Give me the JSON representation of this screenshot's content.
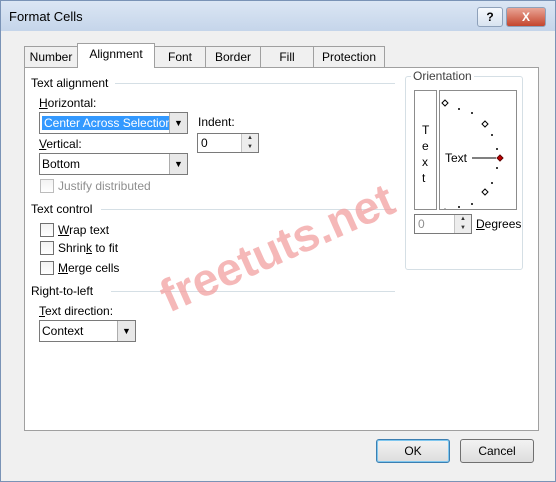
{
  "window": {
    "title": "Format Cells",
    "help_label": "?",
    "close_label": "X"
  },
  "tabs": [
    {
      "label": "Number",
      "active": false
    },
    {
      "label": "Alignment",
      "active": true
    },
    {
      "label": "Font",
      "active": false
    },
    {
      "label": "Border",
      "active": false
    },
    {
      "label": "Fill",
      "active": false
    },
    {
      "label": "Protection",
      "active": false
    }
  ],
  "text_alignment": {
    "group_label": "Text alignment",
    "horizontal_label": "Horizontal:",
    "horizontal_value": "Center Across Selection",
    "vertical_label": "Vertical:",
    "vertical_value": "Bottom",
    "indent_label": "Indent:",
    "indent_value": "0",
    "justify_distributed_label": "Justify distributed"
  },
  "text_control": {
    "group_label": "Text control",
    "wrap_text_label": "Wrap text",
    "shrink_to_fit_label": "Shrink to fit",
    "merge_cells_label": "Merge cells"
  },
  "right_to_left": {
    "group_label": "Right-to-left",
    "text_direction_label": "Text direction:",
    "text_direction_value": "Context"
  },
  "orientation": {
    "group_label": "Orientation",
    "vertical_text": [
      "T",
      "e",
      "x",
      "t"
    ],
    "dial_text": "Text",
    "degrees_value": "0",
    "degrees_label": "Degrees",
    "accent_color": "#c00000"
  },
  "buttons": {
    "ok_label": "OK",
    "cancel_label": "Cancel"
  },
  "watermark": {
    "text": "freetuts.net",
    "color": "#f2a0a0"
  }
}
